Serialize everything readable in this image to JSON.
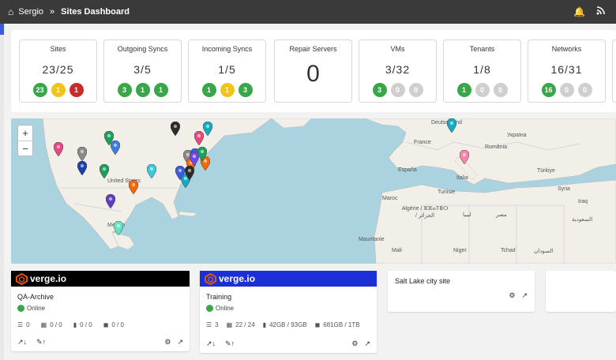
{
  "header": {
    "user": "Sergio",
    "separator": "»",
    "page_title": "Sites Dashboard",
    "icons": [
      "home-icon",
      "bell-icon",
      "rss-icon"
    ]
  },
  "stats": [
    {
      "label": "Sites",
      "value": "23/25",
      "badges": [
        {
          "text": "23",
          "color": "#3aa64a"
        },
        {
          "text": "1",
          "color": "#f0c419"
        },
        {
          "text": "1",
          "color": "#c92a2a"
        }
      ]
    },
    {
      "label": "Outgoing Syncs",
      "value": "3/5",
      "badges": [
        {
          "text": "3",
          "color": "#3aa64a"
        },
        {
          "text": "1",
          "color": "#3aa64a"
        },
        {
          "text": "1",
          "color": "#3aa64a"
        }
      ]
    },
    {
      "label": "Incoming Syncs",
      "value": "1/5",
      "badges": [
        {
          "text": "1",
          "color": "#3aa64a"
        },
        {
          "text": "1",
          "color": "#f0c419"
        },
        {
          "text": "3",
          "color": "#3aa64a"
        }
      ]
    },
    {
      "label": "Repair Servers",
      "value": "0",
      "badges": []
    },
    {
      "label": "VMs",
      "value": "3/32",
      "badges": [
        {
          "text": "3",
          "color": "#3aa64a"
        },
        {
          "text": "0",
          "color": "#cfcfcf"
        },
        {
          "text": "0",
          "color": "#cfcfcf"
        }
      ]
    },
    {
      "label": "Tenants",
      "value": "1/8",
      "badges": [
        {
          "text": "1",
          "color": "#3aa64a"
        },
        {
          "text": "0",
          "color": "#cfcfcf"
        },
        {
          "text": "0",
          "color": "#cfcfcf"
        }
      ]
    },
    {
      "label": "Networks",
      "value": "16/31",
      "badges": [
        {
          "text": "16",
          "color": "#3aa64a"
        },
        {
          "text": "0",
          "color": "#cfcfcf"
        },
        {
          "text": "0",
          "color": "#cfcfcf"
        }
      ]
    }
  ],
  "map": {
    "zoom_in": "+",
    "zoom_out": "−",
    "labels": [
      "United States",
      "Mexico",
      "France",
      "Deutschland",
      "España",
      "Italia",
      "România",
      "Україна",
      "Türkiye",
      "Algérie / ⵣⵣⴰⵢⴻⵔ / الجزائر",
      "ليبيا",
      "مصر",
      "Maroc",
      "Tunisie",
      "Mali",
      "Niger",
      "Tchad",
      "السعودية",
      "السودان",
      "Mauritanie",
      "Iraq",
      "Syria"
    ],
    "markers": [
      {
        "color": "#1f9e5b"
      },
      {
        "color": "#e64980"
      },
      {
        "color": "#8a8a8a"
      },
      {
        "color": "#3b7dd8"
      },
      {
        "color": "#1f9e5b"
      },
      {
        "color": "#2c2c2c"
      },
      {
        "color": "#15aabf"
      },
      {
        "color": "#e64980"
      },
      {
        "color": "#1c3faa"
      },
      {
        "color": "#8a8a8a"
      },
      {
        "color": "#3b5bdb"
      },
      {
        "color": "#f76707"
      },
      {
        "color": "#f76707"
      },
      {
        "color": "#7048e8"
      },
      {
        "color": "#1f9e5b"
      },
      {
        "color": "#3bc9db"
      },
      {
        "color": "#15aabf"
      },
      {
        "color": "#2c2c2c"
      },
      {
        "color": "#5f3dc4"
      },
      {
        "color": "#3b5bdb"
      },
      {
        "color": "#63e6be"
      },
      {
        "color": "#f76707"
      },
      {
        "color": "#15aabf"
      },
      {
        "color": "#f783ac"
      }
    ]
  },
  "cards": [
    {
      "brand": "verge.io",
      "brand_bg": "#000000",
      "name": "QA-Archive",
      "status": "Online",
      "m1": "0",
      "m2": "0 / 0",
      "m3": "0 / 0",
      "m4": "0 / 0"
    },
    {
      "brand": "verge.io",
      "brand_bg": "#1c2fd6",
      "name": "Training",
      "status": "Online",
      "m1": "3",
      "m2": "22 / 24",
      "m3": "42GB / 93GB",
      "m4": "681GB / 1TB"
    }
  ],
  "simple_card": {
    "title": "Salt Lake city site"
  }
}
